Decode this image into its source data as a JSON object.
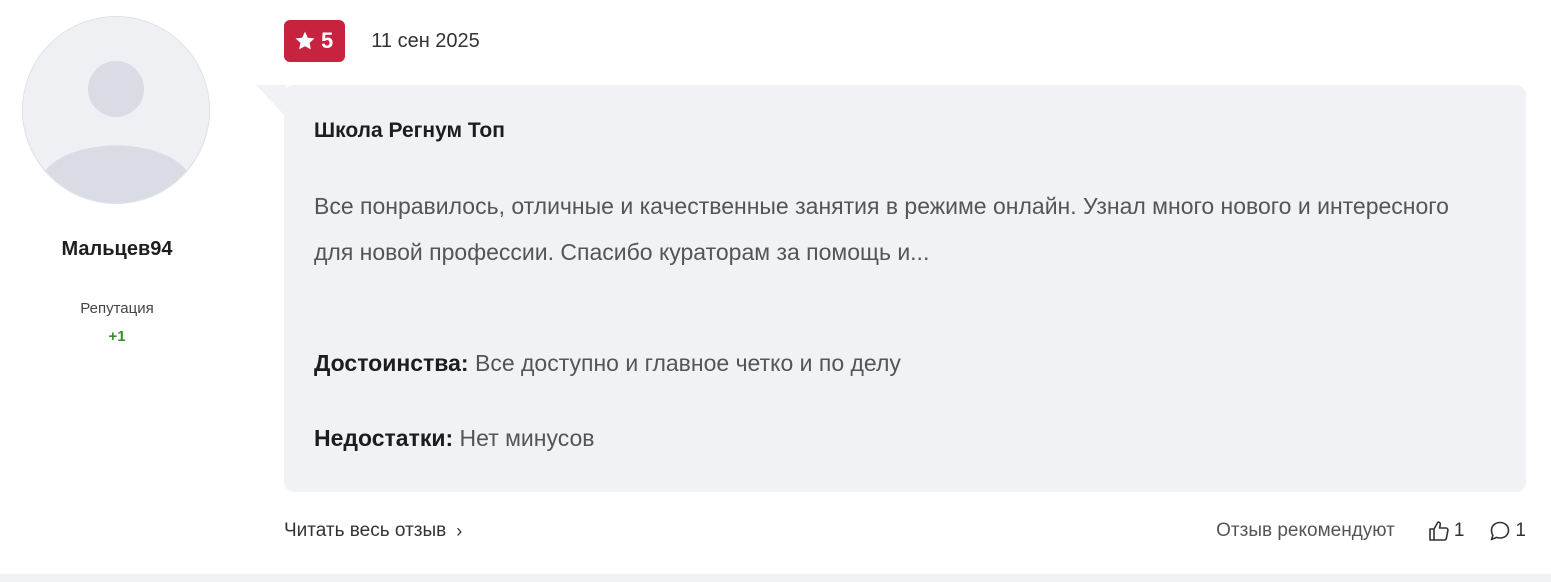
{
  "author": {
    "name": "Мальцев94",
    "reputation_label": "Репутация",
    "reputation_value": "+1"
  },
  "review": {
    "rating": "5",
    "date": "11 сен 2025",
    "title": "Школа Регнум Топ",
    "text": "Все понравилось, отличные и качественные занятия в режиме онлайн. Узнал много нового и интересного для новой профессии. Спасибо кураторам за помощь и...",
    "pros_label": "Достоинства:",
    "pros_text": " Все доступно и главное четко и по делу",
    "cons_label": "Недостатки:",
    "cons_text": " Нет минусов"
  },
  "footer": {
    "read_more": "Читать весь отзыв",
    "recommend_label": "Отзыв рекомендуют",
    "likes": "1",
    "comments": "1"
  },
  "icons": {
    "rating": "star-icon",
    "avatar": "user-placeholder-icon",
    "like": "thumbs-up-icon",
    "comment": "comment-bubble-icon",
    "read_more": "chevron-right-icon"
  },
  "colors": {
    "rating_badge": "#c8233e",
    "bubble_bg": "#f1f2f5",
    "reputation": "#3a8a2e"
  }
}
